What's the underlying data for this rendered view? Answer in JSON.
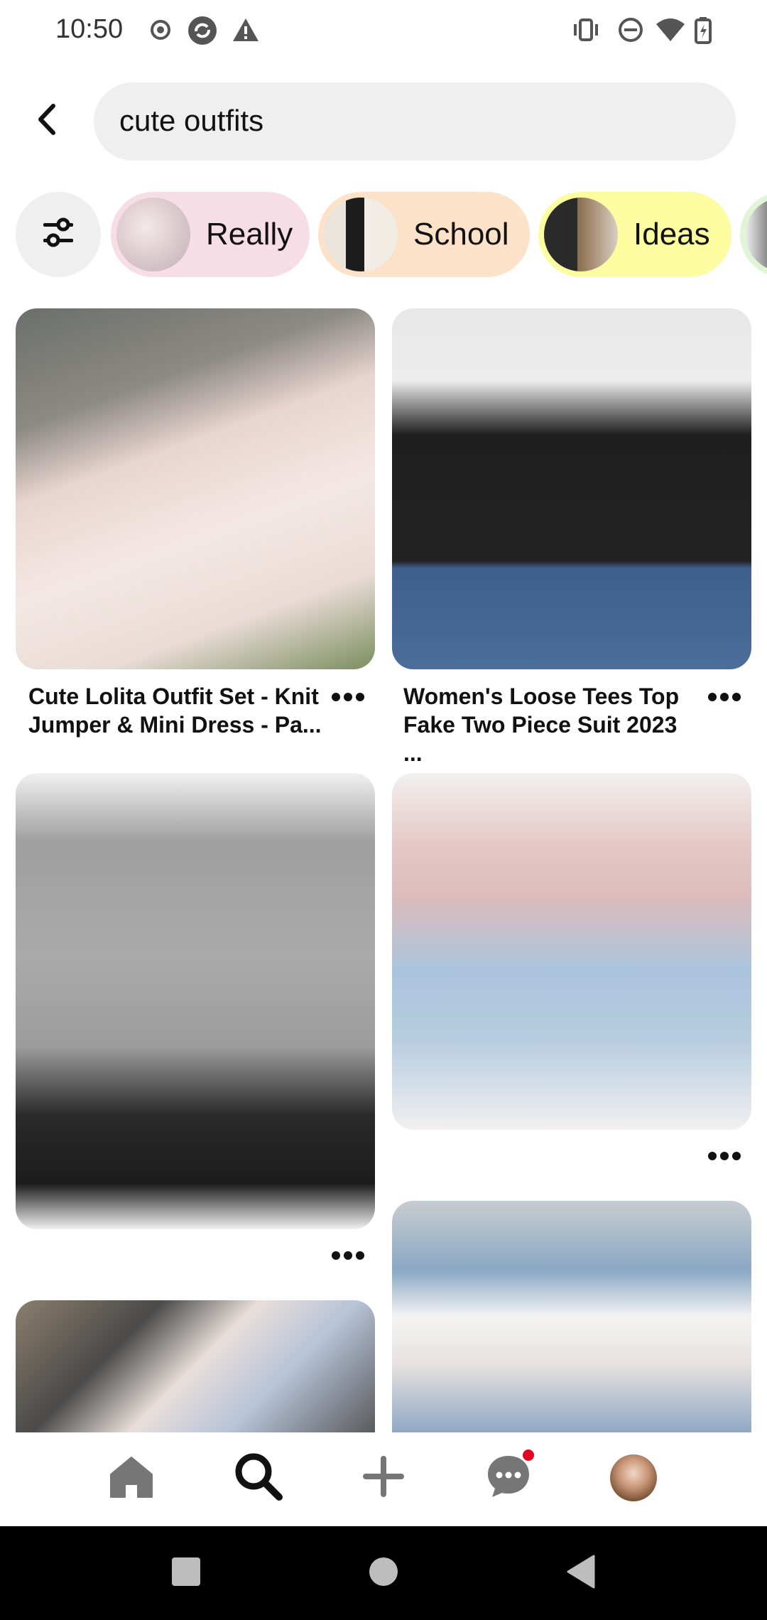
{
  "status_bar": {
    "time": "10:50",
    "icons": [
      "record-icon",
      "sync-icon",
      "warning-icon",
      "vibrate-icon",
      "dnd-icon",
      "wifi-icon",
      "battery-icon"
    ]
  },
  "search": {
    "query": "cute outfits",
    "back_icon": "back-arrow-icon"
  },
  "chips": [
    {
      "label": "Really",
      "bg": "#f7dde6"
    },
    {
      "label": "School",
      "bg": "#fbe2c9"
    },
    {
      "label": "Ideas",
      "bg": "#fcfca0"
    }
  ],
  "pins": [
    {
      "title": "Cute Lolita Outfit Set - Knit Jumper & Mini Dress - Pa..."
    },
    {
      "title": "Women's Loose Tees Top Fake Two Piece Suit 2023 ..."
    }
  ],
  "bottom_nav": {
    "items": [
      "home-icon",
      "search-icon",
      "create-icon",
      "messages-icon",
      "profile-avatar"
    ],
    "active": "search-icon",
    "notification_color": "#e60023"
  },
  "system_nav": [
    "recents-icon",
    "home-circle-icon",
    "back-triangle-icon"
  ]
}
